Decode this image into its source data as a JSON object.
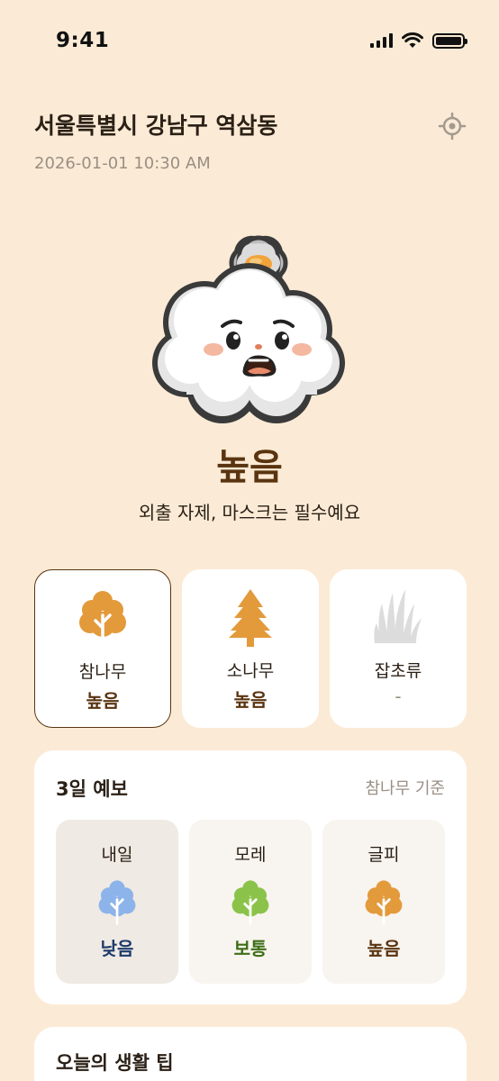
{
  "status": {
    "time": "9:41"
  },
  "header": {
    "location": "서울특별시 강남구 역삼동",
    "datetime": "2026-01-01 10:30 AM"
  },
  "current": {
    "level": "높음",
    "advice": "외출 자제, 마스크는 필수예요",
    "level_color": "#5A3410"
  },
  "pollen_types": [
    {
      "name": "참나무",
      "value": "높음",
      "icon": "oak-tree-icon",
      "color": "#E39A3B",
      "selected": true
    },
    {
      "name": "소나무",
      "value": "높음",
      "icon": "pine-tree-icon",
      "color": "#E39A3B",
      "selected": false
    },
    {
      "name": "잡초류",
      "value": "-",
      "icon": "grass-icon",
      "color": "#DCDCDC",
      "selected": false
    }
  ],
  "forecast": {
    "title": "3일 예보",
    "basis": "참나무 기준",
    "days": [
      {
        "day": "내일",
        "value": "낮음",
        "color": "#8DB4EA",
        "text_color": "#1F3A6B"
      },
      {
        "day": "모레",
        "value": "보통",
        "color": "#8BC34A",
        "text_color": "#3E6E17"
      },
      {
        "day": "글피",
        "value": "높음",
        "color": "#E39A3B",
        "text_color": "#5A3410"
      }
    ]
  },
  "tips": {
    "title": "오늘의 생활 팁"
  }
}
